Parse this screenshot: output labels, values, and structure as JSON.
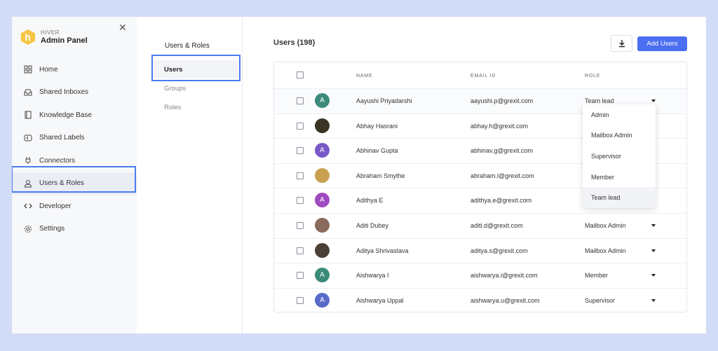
{
  "brand": {
    "small": "HIVER",
    "title": "Admin Panel"
  },
  "sidebar": {
    "items": [
      {
        "label": "Home",
        "icon": "grid-icon"
      },
      {
        "label": "Shared Inboxes",
        "icon": "inbox-icon"
      },
      {
        "label": "Knowledge Base",
        "icon": "book-icon"
      },
      {
        "label": "Shared Labels",
        "icon": "label-icon"
      },
      {
        "label": "Connectors",
        "icon": "plug-icon"
      },
      {
        "label": "Users & Roles",
        "icon": "user-icon",
        "active": true
      },
      {
        "label": "Developer",
        "icon": "code-icon"
      },
      {
        "label": "Settings",
        "icon": "gear-icon"
      }
    ]
  },
  "subnav": {
    "title": "Users & Roles",
    "items": [
      {
        "label": "Users",
        "active": true
      },
      {
        "label": "Groups"
      },
      {
        "label": "Roles"
      }
    ]
  },
  "main": {
    "title": "Users (198)",
    "add_label": "Add Users"
  },
  "table": {
    "columns": {
      "name": "NAME",
      "email": "EMAIL ID",
      "role": "ROLE"
    },
    "rows": [
      {
        "initial": "A",
        "avatar_color": "#3b8a7a",
        "name": "Aayushi Priyadarshi",
        "email": "aayushi.p@grexit.com",
        "role": "Team lead"
      },
      {
        "initial": "",
        "avatar_color": "#3a3424",
        "name": "Abhay Hasrani",
        "email": "abhay.h@grexit.com",
        "role": ""
      },
      {
        "initial": "A",
        "avatar_color": "#7a5ac8",
        "name": "Abhinav Gupta",
        "email": "abhinav.g@grexit.com",
        "role": ""
      },
      {
        "initial": "",
        "avatar_color": "#c8a050",
        "name": "Abraham Smythe",
        "email": "abraham.l@grexit.com",
        "role": ""
      },
      {
        "initial": "A",
        "avatar_color": "#a04ac0",
        "name": "Adithya E",
        "email": "adithya.e@grexit.com",
        "role": ""
      },
      {
        "initial": "",
        "avatar_color": "#8a6a5a",
        "name": "Aditi Dubey",
        "email": "aditi.d@grexit.com",
        "role": "Mailbox Admin"
      },
      {
        "initial": "",
        "avatar_color": "#4a4036",
        "name": "Aditya Shrivastava",
        "email": "aditya.s@grexit.com",
        "role": "Mailbox Admin"
      },
      {
        "initial": "A",
        "avatar_color": "#3b8a7a",
        "name": "Aishwarya I",
        "email": "aishwarya.i@grexit.com",
        "role": "Member"
      },
      {
        "initial": "A",
        "avatar_color": "#5a6ac8",
        "name": "Aishwarya Uppal",
        "email": "aishwarya.u@grexit.com",
        "role": "Supervisor"
      }
    ]
  },
  "dropdown": {
    "options": [
      "Admin",
      "Mailbox Admin",
      "Supervisor",
      "Member",
      "Team lead"
    ],
    "selected": "Team lead"
  },
  "colors": {
    "accent": "#4b6ff0",
    "highlight": "#4a7cf0",
    "logo": "#f5c542"
  }
}
